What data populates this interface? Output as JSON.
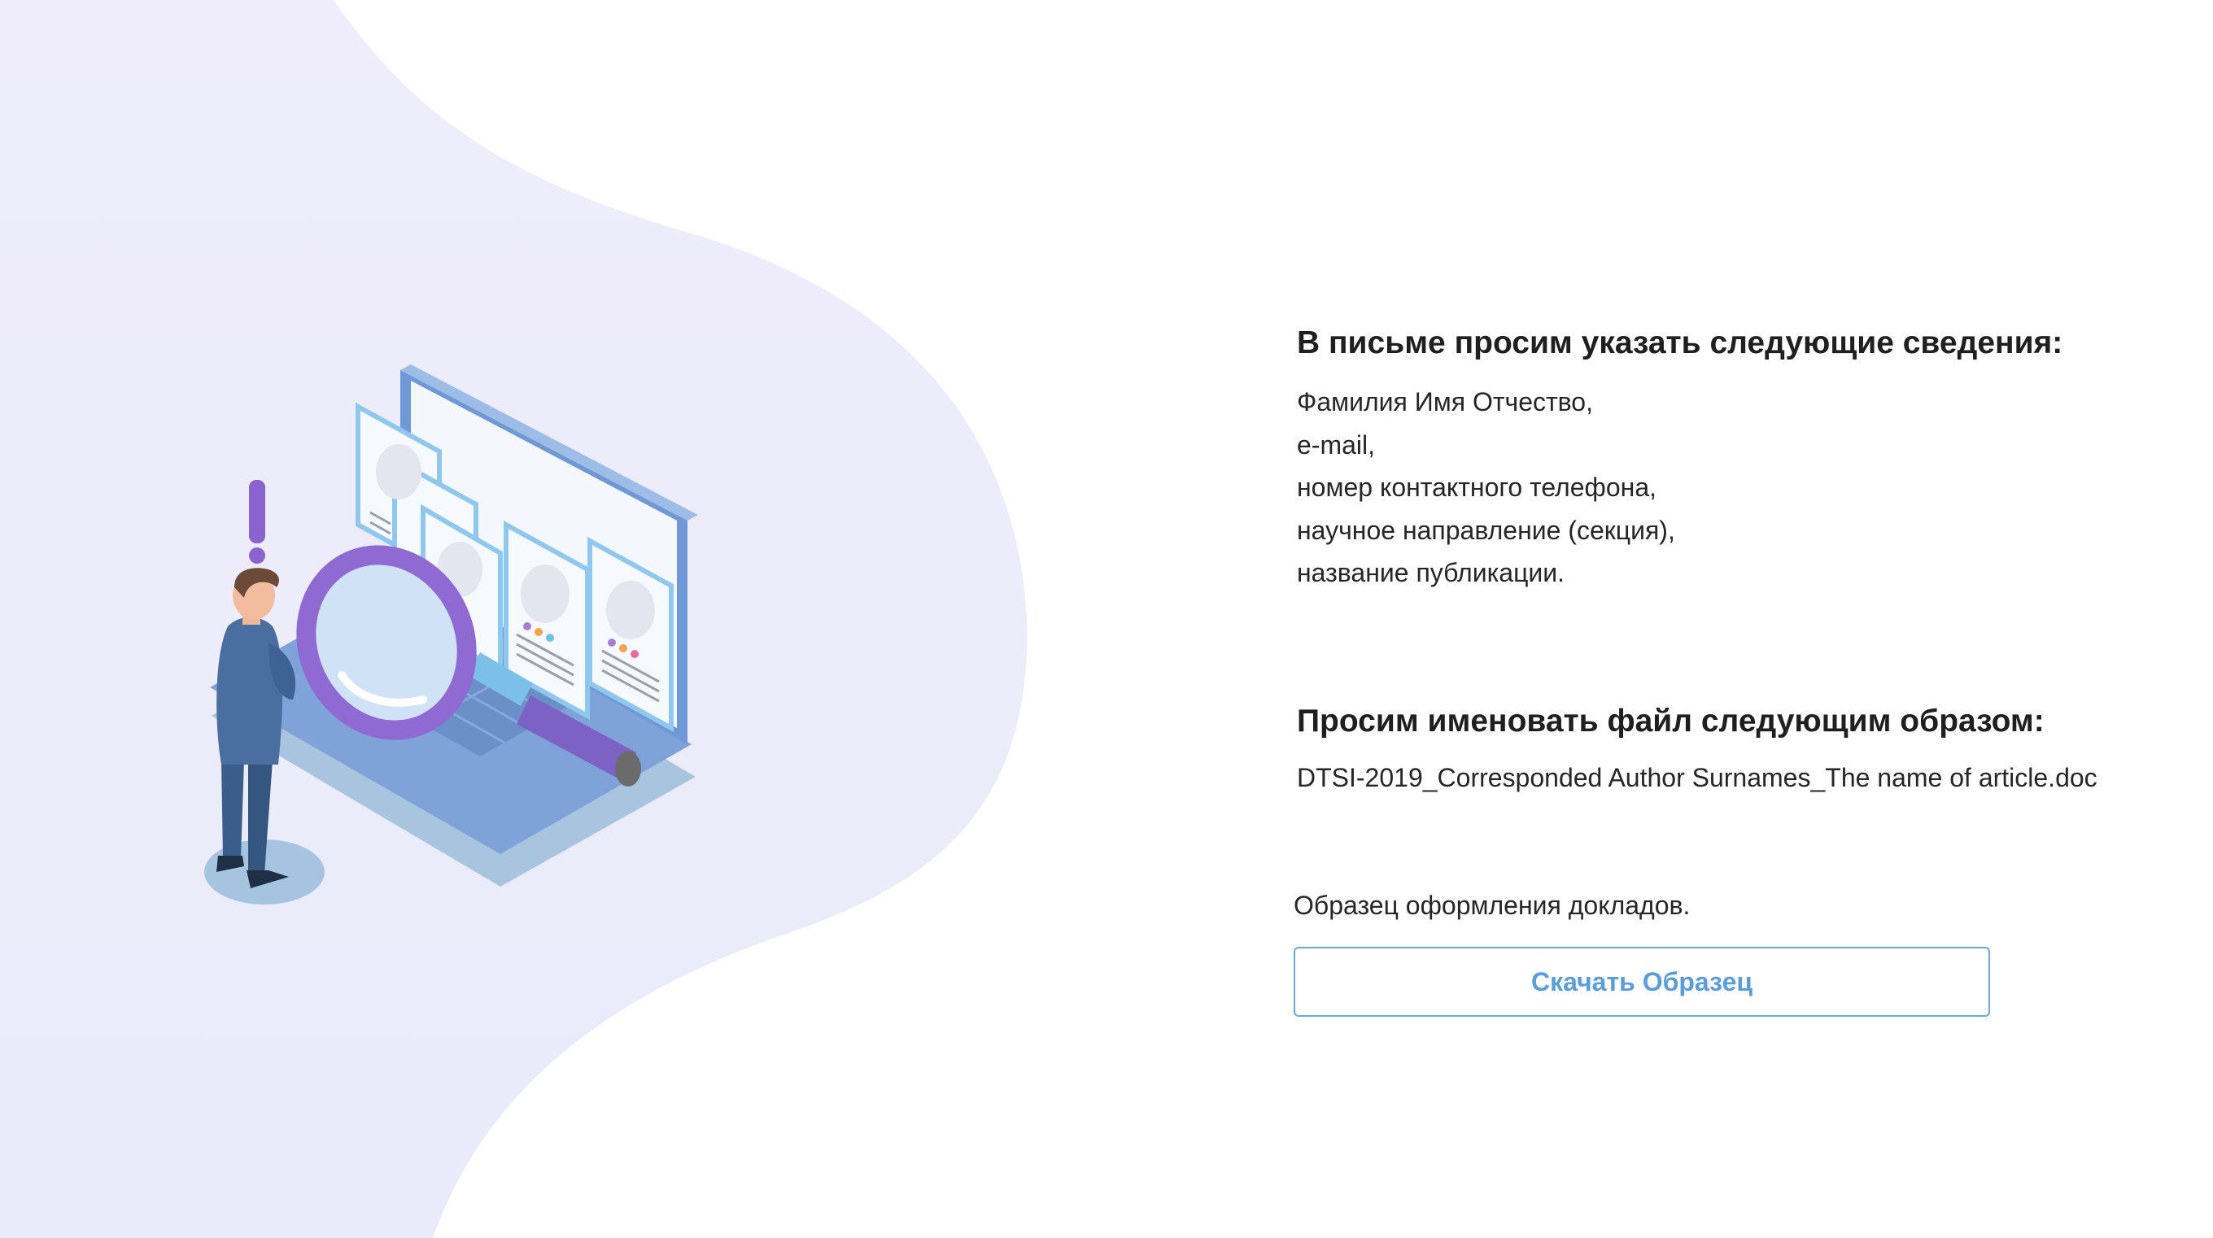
{
  "section1": {
    "heading": "В письме просим указать следующие сведения:",
    "items": [
      "Фамилия Имя Отчество,",
      "e-mail,",
      "номер контактного телефона,",
      "научное направление (секция),",
      "название публикации."
    ]
  },
  "section2": {
    "heading": "Просим именовать файл следующим образом:",
    "filename": "DTSI-2019_Corresponded Author Surnames_The name of article.doc"
  },
  "sample": {
    "caption": "Образец оформления докладов.",
    "button_label": "Скачать Образец"
  },
  "colors": {
    "blob": "#ebebfa",
    "button_border": "#6aa9df",
    "button_text": "#5b9ddb",
    "heading_text": "#1f1f1f"
  },
  "icons": {
    "illustration": "person-magnifier-laptop-illustration",
    "exclamation": "exclamation-icon"
  }
}
